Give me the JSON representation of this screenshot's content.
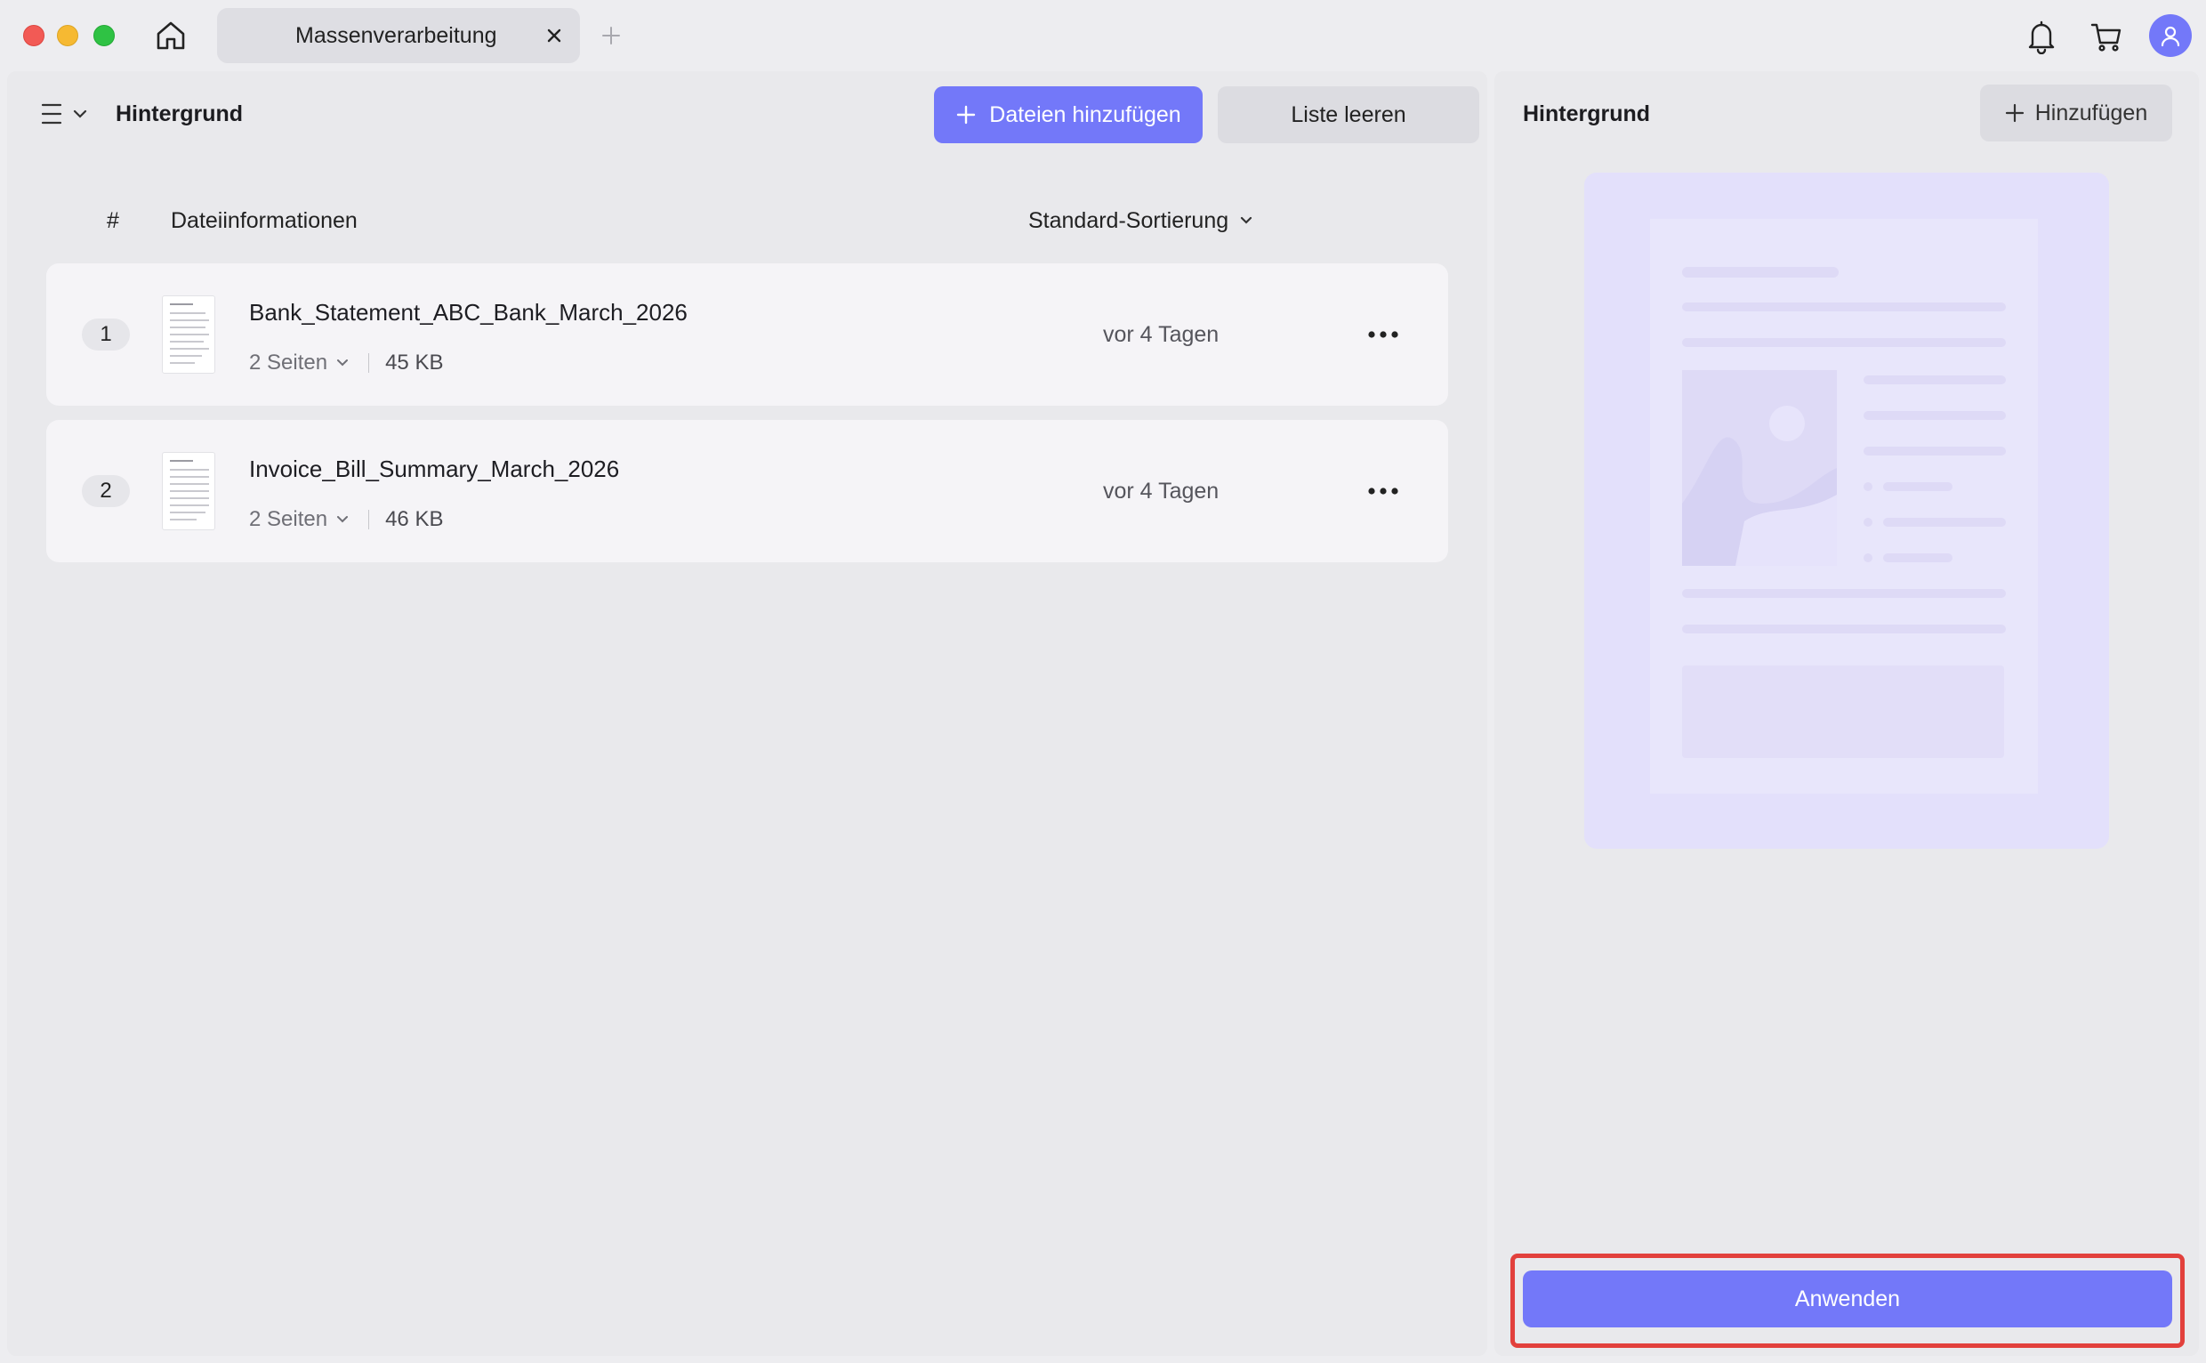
{
  "titlebar": {
    "tab_title": "Massenverarbeitung",
    "icons": [
      "home-icon",
      "close-icon",
      "plus-icon",
      "bell-icon",
      "cart-icon",
      "user-icon"
    ]
  },
  "left_panel": {
    "title": "Hintergrund",
    "add_files_label": "Dateien hinzufügen",
    "clear_list_label": "Liste leeren",
    "header": {
      "index": "#",
      "info": "Dateiinformationen",
      "sort": "Standard-Sortierung"
    },
    "files": [
      {
        "index": "1",
        "name": "Bank_Statement_ABC_Bank_March_2026",
        "pages": "2 Seiten",
        "size": "45 KB",
        "date": "vor 4 Tagen"
      },
      {
        "index": "2",
        "name": "Invoice_Bill_Summary_March_2026",
        "pages": "2 Seiten",
        "size": "46 KB",
        "date": "vor 4 Tagen"
      }
    ]
  },
  "right_panel": {
    "title": "Hintergrund",
    "add_label": "Hinzufügen",
    "apply_label": "Anwenden",
    "accent_color": "#7378f9",
    "highlight_color": "#e2403c"
  }
}
